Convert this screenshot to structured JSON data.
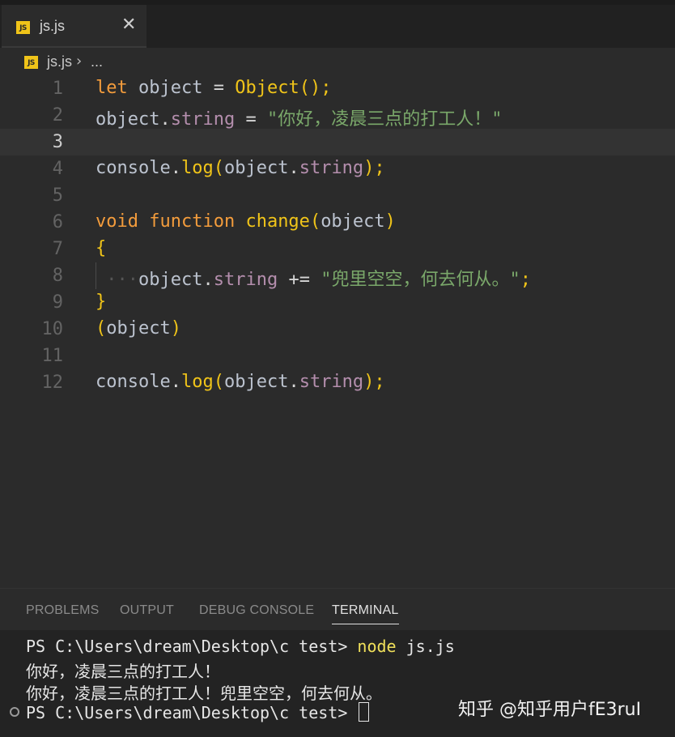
{
  "tab": {
    "icon": "js-icon",
    "icon_text": "JS",
    "label": "js.js",
    "close": "✕"
  },
  "breadcrumb": {
    "icon_text": "JS",
    "file": "js.js",
    "separator": "›",
    "more": "..."
  },
  "editor": {
    "active_line": 3,
    "lines": [
      {
        "n": "1"
      },
      {
        "n": "2"
      },
      {
        "n": "3"
      },
      {
        "n": "4"
      },
      {
        "n": "5"
      },
      {
        "n": "6"
      },
      {
        "n": "7"
      },
      {
        "n": "8"
      },
      {
        "n": "9"
      },
      {
        "n": "10"
      },
      {
        "n": "11"
      },
      {
        "n": "12"
      }
    ],
    "tokens": {
      "l1": [
        "let",
        " object ",
        "=",
        " ",
        "Object",
        "();"
      ],
      "l2": [
        "object",
        ".",
        "string",
        " = ",
        "\"你好，凌晨三点的打工人！\""
      ],
      "l4": [
        "console",
        ".",
        "log",
        "(",
        "object",
        ".",
        "string",
        ");"
      ],
      "l6": [
        "void",
        " ",
        "function",
        " ",
        "change",
        "(",
        "object",
        ")"
      ],
      "l7": [
        "{"
      ],
      "l8": [
        "···",
        "object",
        ".",
        "string",
        " += ",
        "\"兜里空空，何去何从。\"",
        ";"
      ],
      "l9": [
        "}"
      ],
      "l10": [
        "(",
        "object",
        ")"
      ],
      "l12": [
        "console",
        ".",
        "log",
        "(",
        "object",
        ".",
        "string",
        ");"
      ]
    }
  },
  "panel": {
    "tabs": [
      "PROBLEMS",
      "OUTPUT",
      "DEBUG CONSOLE",
      "TERMINAL"
    ],
    "active_tab": "TERMINAL"
  },
  "terminal": {
    "prompt1": "PS C:\\Users\\dream\\Desktop\\c test> ",
    "cmd": "node",
    "args": " js.js",
    "out1": "你好，凌晨三点的打工人！",
    "out2": "你好，凌晨三点的打工人！兜里空空，何去何从。",
    "prompt2": "PS C:\\Users\\dream\\Desktop\\c test> "
  },
  "watermark": "知乎 @知乎用户fE3ruI"
}
